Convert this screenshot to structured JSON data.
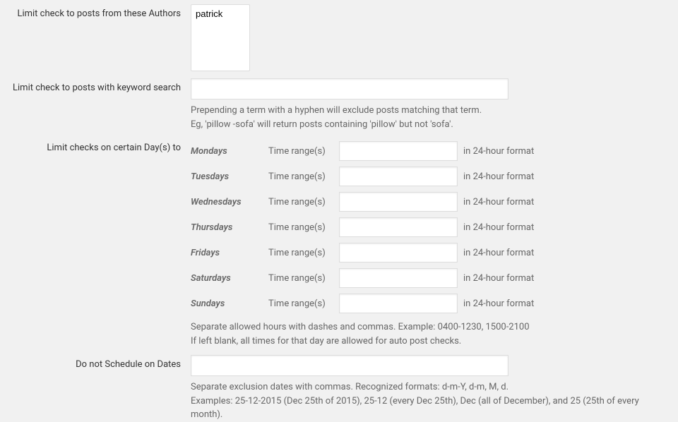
{
  "labels": {
    "authors": "Limit check to posts from these Authors",
    "keyword": "Limit check to posts with keyword search",
    "days": "Limit checks on certain Day(s) to",
    "exclude_dates": "Do not Schedule on Dates"
  },
  "authors": {
    "options": [
      "patrick"
    ],
    "selected": "patrick"
  },
  "keyword": {
    "value": "",
    "help1": "Prepending a term with a hyphen will exclude posts matching that term.",
    "help2": "Eg, 'pillow -sofa' will return posts containing 'pillow' but not 'sofa'."
  },
  "days": {
    "time_range_label": "Time range(s)",
    "suffix": "in 24-hour format",
    "list": [
      {
        "name": "Mondays",
        "value": ""
      },
      {
        "name": "Tuesdays",
        "value": ""
      },
      {
        "name": "Wednesdays",
        "value": ""
      },
      {
        "name": "Thursdays",
        "value": ""
      },
      {
        "name": "Fridays",
        "value": ""
      },
      {
        "name": "Saturdays",
        "value": ""
      },
      {
        "name": "Sundays",
        "value": ""
      }
    ],
    "help1": "Separate allowed hours with dashes and commas. Example: 0400-1230, 1500-2100",
    "help2": "If left blank, all times for that day are allowed for auto post checks."
  },
  "exclude_dates": {
    "value": "",
    "help1": "Separate exclusion dates with commas. Recognized formats: d-m-Y, d-m, M, d.",
    "help2": "Examples: 25-12-2015 (Dec 25th of 2015), 25-12 (every Dec 25th), Dec (all of December), and 25 (25th of every month)."
  }
}
